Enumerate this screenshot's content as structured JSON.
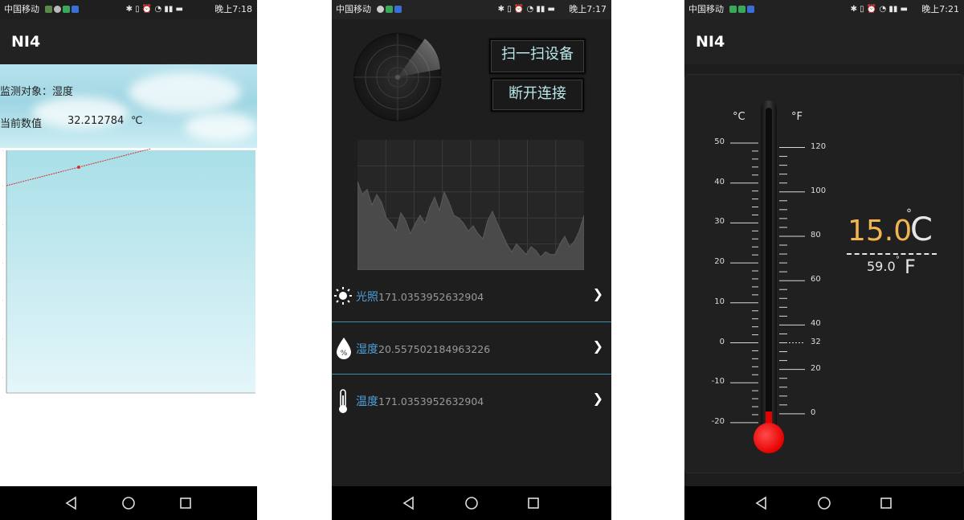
{
  "status_bars": [
    {
      "carrier": "中国移动",
      "time": "晚上7:18"
    },
    {
      "carrier": "中国移动",
      "time": "晚上7:17"
    },
    {
      "carrier": "中国移动",
      "time": "晚上7:21"
    }
  ],
  "colors": {
    "accent_blue": "#4d9fd9",
    "temp_orange": "#f0b550",
    "bulb_red": "#ff1111",
    "chart_line": "#d93030"
  },
  "screen1": {
    "app_title": "NI4",
    "monitor_label": "监测对象：湿度",
    "current_label": "当前数值",
    "current_value": "32.212784",
    "unit": "℃",
    "chart_data": {
      "type": "line",
      "series": [
        {
          "values": [
            0.0,
            0.5,
            1.0
          ]
        }
      ],
      "points_x": [
        0.0,
        0.5,
        1.0
      ]
    }
  },
  "screen2": {
    "scan_button": "扫一扫设备",
    "disconnect_button": "断开连接",
    "sensors": [
      {
        "icon": "sun-icon",
        "label": "光照",
        "value": "171.0353952632904"
      },
      {
        "icon": "humidity-drop-icon",
        "label": "湿度",
        "value": "20.557502184963226"
      },
      {
        "icon": "thermometer-icon",
        "label": "温度",
        "value": "171.0353952632904"
      }
    ],
    "chevron": "❯",
    "wave_values": [
      0.68,
      0.58,
      0.62,
      0.5,
      0.58,
      0.52,
      0.4,
      0.36,
      0.3,
      0.44,
      0.38,
      0.28,
      0.36,
      0.42,
      0.36,
      0.48,
      0.56,
      0.46,
      0.6,
      0.52,
      0.42,
      0.4,
      0.36,
      0.3,
      0.34,
      0.28,
      0.24,
      0.38,
      0.45,
      0.36,
      0.28,
      0.2,
      0.14,
      0.2,
      0.16,
      0.12,
      0.18,
      0.15,
      0.1,
      0.14,
      0.12,
      0.12,
      0.2,
      0.26,
      0.18,
      0.22,
      0.3,
      0.42
    ]
  },
  "screen3": {
    "app_title": "NI4",
    "celsius_symbol": "°C",
    "fahrenheit_symbol": "°F",
    "celsius_ticks": [
      "50",
      "40",
      "30",
      "20",
      "10",
      "0",
      "-10",
      "-20"
    ],
    "fahrenheit_ticks": [
      "120",
      "100",
      "80",
      "60",
      "40",
      "32",
      "20",
      "0"
    ],
    "celsius_value": "15.0",
    "celsius_unit": "C",
    "fahrenheit_value": "59.0",
    "fahrenheit_unit": "F",
    "degree_mark": "°"
  }
}
